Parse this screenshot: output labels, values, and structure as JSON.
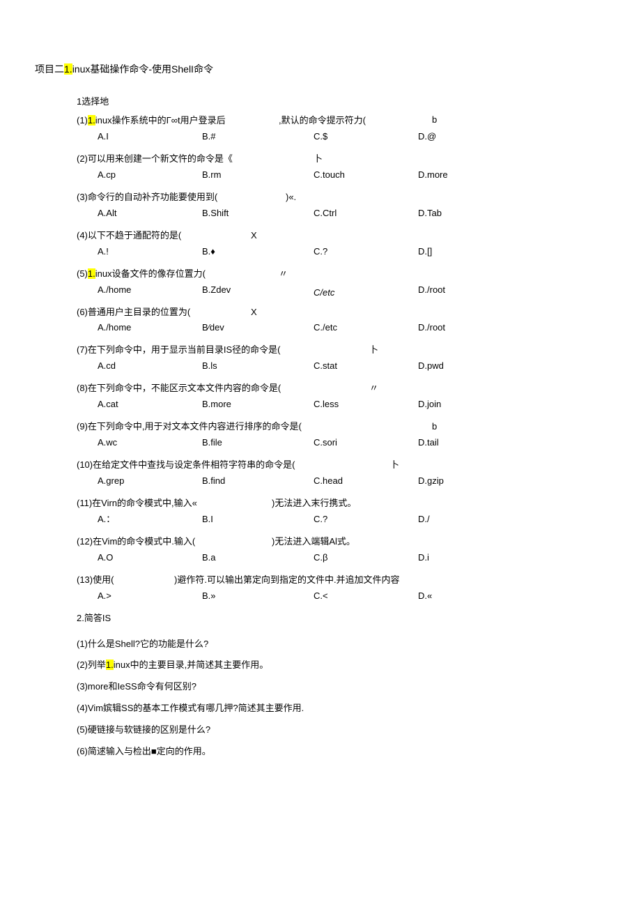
{
  "title_parts": {
    "p1": "项目二",
    "hl1": "1.",
    "p2": "inux基础操作命令-使用ShelI命令"
  },
  "section1_head": "1选择地",
  "questions": [
    {
      "stem_before": "(1)",
      "hl": "1.",
      "stem_after": "inux操作系统中的Γ∞t用户登录后",
      "stem_tail": ",默认的命令提示符力(",
      "ans": "b",
      "A": "A.I",
      "B": "B.#",
      "C": "C.$",
      "D": "D.@"
    },
    {
      "stem": "(2)可以用来创建一个新文忤的命令是《",
      "mid": "卜",
      "A": "A.cp",
      "B": "B.rm",
      "C": "C.touch",
      "D": "D.more"
    },
    {
      "stem": "(3)命令行的自动补齐功能要使用到(",
      "mid": ")«.",
      "A": "A.Alt",
      "B": "B.Shift",
      "C": "C.Ctrl",
      "D": "D.Tab"
    },
    {
      "stem": "(4)以下不趋于通配符的是(",
      "mid": "X",
      "A": "A.!",
      "B": "B.♦",
      "C": "C.?",
      "D": "D.[]"
    },
    {
      "stem_before": "(5)",
      "hl": "1.",
      "stem_after": "inux设备文件的像存位置力(",
      "mid": "〃",
      "A": "A./home",
      "B": "B.Zdev",
      "C": "C/etc",
      "Citalic": true,
      "D": "D./root"
    },
    {
      "stem": "(6)普通用户主目录的位置为(",
      "mid": "X",
      "A": "A./home",
      "B": "B∕dev",
      "C": "C./etc",
      "D": "D./root"
    },
    {
      "stem": "(7)在下列命令中，用于显示当前目录IS径的命令是(",
      "mid": "卜",
      "A": "A.cd",
      "B": "B.ls",
      "C": "C.stat",
      "D": "D.pwd"
    },
    {
      "stem": "(8)在下列命令中，不能区示文本文件内容的命令是(",
      "mid": "〃",
      "A": "A.cat",
      "B": "B.more",
      "C": "C.less",
      "D": "D.join"
    },
    {
      "stem": "(9)在下列命令中,用于对文本文件内容进行排序的命令是(",
      "ans": "b",
      "A": "A.wc",
      "B": "B.file",
      "C": "C.sori",
      "D": "D.tail"
    },
    {
      "stem": "(10)在给定文件中查找与设定条件相符字符串的命令是(",
      "mid": "卜",
      "A": "A.grep",
      "B": "B.find",
      "C": "C.head",
      "D": "D.gzip"
    },
    {
      "stem": "(11)在Virn的命令模式中,输入«",
      "mid": ")无法进入末行携式。",
      "A": "A.：",
      "B": "B.I",
      "C": "C.?",
      "D": "D./"
    },
    {
      "stem": "(12)在Vim的命令模式中.输入(",
      "mid": ")无法进入端辑Al式。",
      "A": "A.O",
      "B": "B.a",
      "C": "C.β",
      "D": "D.i"
    },
    {
      "stem": "(13)使用(",
      "mid": ")避作符.可以输出第定向到指定的文件中.并追加文件内容",
      "A": "A.>",
      "B": "B.»",
      "C": "C.<",
      "D": "D.«"
    }
  ],
  "section2_head": "2.简答IS",
  "short_answers": [
    {
      "text": "(1)什么是Shell?它的功能是什么?"
    },
    {
      "before": "(2)列举",
      "hl": "1.",
      "after": "inux中的主要目录,并简述其主要作用。"
    },
    {
      "text": "(3)more和IeSS命令有何区别?"
    },
    {
      "text": "(4)Vim嫔辑SS的基本工作模式有哪几押?简述其主要作用."
    },
    {
      "text": "(5)硬链接与软链接的区别是什么?"
    },
    {
      "text": "(6)简逑输入与检出■定向的作用。"
    }
  ]
}
